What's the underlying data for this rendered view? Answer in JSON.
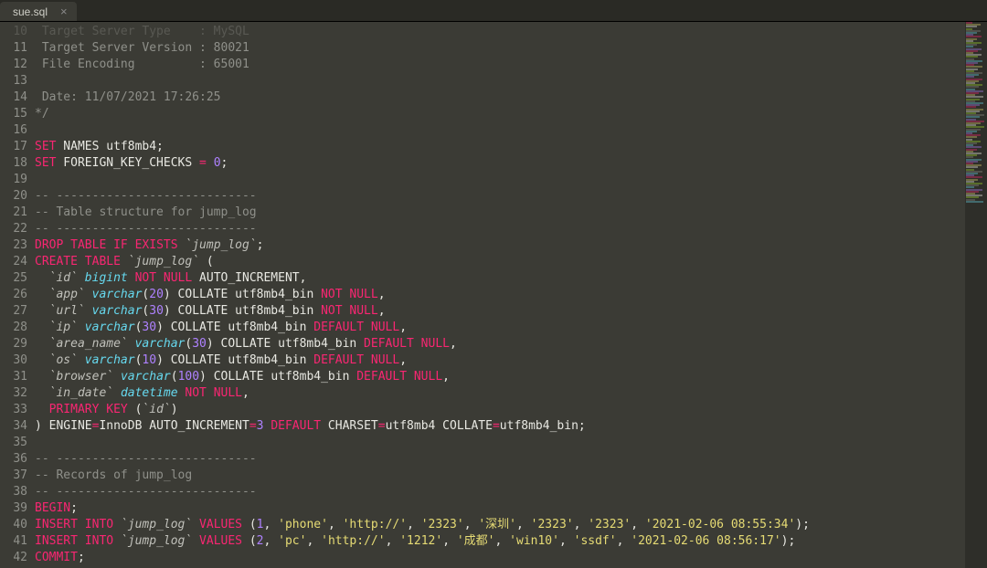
{
  "tab": {
    "title": "sue.sql",
    "close": "×"
  },
  "lines": [
    {
      "n": 10,
      "faded": true,
      "segs": [
        {
          "cls": "c-comment",
          "t": " Target Server Type    : MySQL"
        }
      ]
    },
    {
      "n": 11,
      "segs": [
        {
          "cls": "c-comment",
          "t": " Target Server Version : 80021"
        }
      ]
    },
    {
      "n": 12,
      "segs": [
        {
          "cls": "c-comment",
          "t": " File Encoding         : 65001"
        }
      ]
    },
    {
      "n": 13,
      "segs": [
        {
          "cls": "c-comment",
          "t": ""
        }
      ]
    },
    {
      "n": 14,
      "segs": [
        {
          "cls": "c-comment",
          "t": " Date: 11/07/2021 17:26:25"
        }
      ]
    },
    {
      "n": 15,
      "segs": [
        {
          "cls": "c-comment",
          "t": "*/"
        }
      ]
    },
    {
      "n": 16,
      "segs": [
        {
          "cls": "",
          "t": ""
        }
      ]
    },
    {
      "n": 17,
      "segs": [
        {
          "cls": "c-kw",
          "t": "SET"
        },
        {
          "cls": "c-plain",
          "t": " NAMES utf8mb4;"
        }
      ]
    },
    {
      "n": 18,
      "segs": [
        {
          "cls": "c-kw",
          "t": "SET"
        },
        {
          "cls": "c-plain",
          "t": " FOREIGN_KEY_CHECKS "
        },
        {
          "cls": "c-kw",
          "t": "="
        },
        {
          "cls": "c-plain",
          "t": " "
        },
        {
          "cls": "c-num",
          "t": "0"
        },
        {
          "cls": "c-plain",
          "t": ";"
        }
      ]
    },
    {
      "n": 19,
      "segs": [
        {
          "cls": "",
          "t": ""
        }
      ]
    },
    {
      "n": 20,
      "segs": [
        {
          "cls": "c-comment",
          "t": "-- ----------------------------"
        }
      ]
    },
    {
      "n": 21,
      "segs": [
        {
          "cls": "c-comment",
          "t": "-- Table structure for jump_log"
        }
      ]
    },
    {
      "n": 22,
      "segs": [
        {
          "cls": "c-comment",
          "t": "-- ----------------------------"
        }
      ]
    },
    {
      "n": 23,
      "segs": [
        {
          "cls": "c-kw",
          "t": "DROP"
        },
        {
          "cls": "c-plain",
          "t": " "
        },
        {
          "cls": "c-kw",
          "t": "TABLE"
        },
        {
          "cls": "c-plain",
          "t": " "
        },
        {
          "cls": "c-kw",
          "t": "IF"
        },
        {
          "cls": "c-plain",
          "t": " "
        },
        {
          "cls": "c-kw",
          "t": "EXISTS"
        },
        {
          "cls": "c-plain",
          "t": " "
        },
        {
          "cls": "c-tbl",
          "t": "`jump_log`"
        },
        {
          "cls": "c-plain",
          "t": ";"
        }
      ]
    },
    {
      "n": 24,
      "segs": [
        {
          "cls": "c-kw",
          "t": "CREATE"
        },
        {
          "cls": "c-plain",
          "t": " "
        },
        {
          "cls": "c-kw",
          "t": "TABLE"
        },
        {
          "cls": "c-plain",
          "t": " "
        },
        {
          "cls": "c-tbl",
          "t": "`jump_log`"
        },
        {
          "cls": "c-plain",
          "t": " ("
        }
      ]
    },
    {
      "n": 25,
      "segs": [
        {
          "cls": "c-plain",
          "t": "  "
        },
        {
          "cls": "c-tbl",
          "t": "`id`"
        },
        {
          "cls": "c-plain",
          "t": " "
        },
        {
          "cls": "c-type",
          "t": "bigint"
        },
        {
          "cls": "c-plain",
          "t": " "
        },
        {
          "cls": "c-kw",
          "t": "NOT"
        },
        {
          "cls": "c-plain",
          "t": " "
        },
        {
          "cls": "c-kw",
          "t": "NULL"
        },
        {
          "cls": "c-plain",
          "t": " AUTO_INCREMENT,"
        }
      ]
    },
    {
      "n": 26,
      "segs": [
        {
          "cls": "c-plain",
          "t": "  "
        },
        {
          "cls": "c-tbl",
          "t": "`app`"
        },
        {
          "cls": "c-plain",
          "t": " "
        },
        {
          "cls": "c-type",
          "t": "varchar"
        },
        {
          "cls": "c-plain",
          "t": "("
        },
        {
          "cls": "c-num",
          "t": "20"
        },
        {
          "cls": "c-plain",
          "t": ") COLLATE utf8mb4_bin "
        },
        {
          "cls": "c-kw",
          "t": "NOT"
        },
        {
          "cls": "c-plain",
          "t": " "
        },
        {
          "cls": "c-kw",
          "t": "NULL"
        },
        {
          "cls": "c-plain",
          "t": ","
        }
      ]
    },
    {
      "n": 27,
      "segs": [
        {
          "cls": "c-plain",
          "t": "  "
        },
        {
          "cls": "c-tbl",
          "t": "`url`"
        },
        {
          "cls": "c-plain",
          "t": " "
        },
        {
          "cls": "c-type",
          "t": "varchar"
        },
        {
          "cls": "c-plain",
          "t": "("
        },
        {
          "cls": "c-num",
          "t": "30"
        },
        {
          "cls": "c-plain",
          "t": ") COLLATE utf8mb4_bin "
        },
        {
          "cls": "c-kw",
          "t": "NOT"
        },
        {
          "cls": "c-plain",
          "t": " "
        },
        {
          "cls": "c-kw",
          "t": "NULL"
        },
        {
          "cls": "c-plain",
          "t": ","
        }
      ]
    },
    {
      "n": 28,
      "segs": [
        {
          "cls": "c-plain",
          "t": "  "
        },
        {
          "cls": "c-tbl",
          "t": "`ip`"
        },
        {
          "cls": "c-plain",
          "t": " "
        },
        {
          "cls": "c-type",
          "t": "varchar"
        },
        {
          "cls": "c-plain",
          "t": "("
        },
        {
          "cls": "c-num",
          "t": "30"
        },
        {
          "cls": "c-plain",
          "t": ") COLLATE utf8mb4_bin "
        },
        {
          "cls": "c-kw",
          "t": "DEFAULT"
        },
        {
          "cls": "c-plain",
          "t": " "
        },
        {
          "cls": "c-kw",
          "t": "NULL"
        },
        {
          "cls": "c-plain",
          "t": ","
        }
      ]
    },
    {
      "n": 29,
      "segs": [
        {
          "cls": "c-plain",
          "t": "  "
        },
        {
          "cls": "c-tbl",
          "t": "`area_name`"
        },
        {
          "cls": "c-plain",
          "t": " "
        },
        {
          "cls": "c-type",
          "t": "varchar"
        },
        {
          "cls": "c-plain",
          "t": "("
        },
        {
          "cls": "c-num",
          "t": "30"
        },
        {
          "cls": "c-plain",
          "t": ") COLLATE utf8mb4_bin "
        },
        {
          "cls": "c-kw",
          "t": "DEFAULT"
        },
        {
          "cls": "c-plain",
          "t": " "
        },
        {
          "cls": "c-kw",
          "t": "NULL"
        },
        {
          "cls": "c-plain",
          "t": ","
        }
      ]
    },
    {
      "n": 30,
      "segs": [
        {
          "cls": "c-plain",
          "t": "  "
        },
        {
          "cls": "c-tbl",
          "t": "`os`"
        },
        {
          "cls": "c-plain",
          "t": " "
        },
        {
          "cls": "c-type",
          "t": "varchar"
        },
        {
          "cls": "c-plain",
          "t": "("
        },
        {
          "cls": "c-num",
          "t": "10"
        },
        {
          "cls": "c-plain",
          "t": ") COLLATE utf8mb4_bin "
        },
        {
          "cls": "c-kw",
          "t": "DEFAULT"
        },
        {
          "cls": "c-plain",
          "t": " "
        },
        {
          "cls": "c-kw",
          "t": "NULL"
        },
        {
          "cls": "c-plain",
          "t": ","
        }
      ]
    },
    {
      "n": 31,
      "segs": [
        {
          "cls": "c-plain",
          "t": "  "
        },
        {
          "cls": "c-tbl",
          "t": "`browser`"
        },
        {
          "cls": "c-plain",
          "t": " "
        },
        {
          "cls": "c-type",
          "t": "varchar"
        },
        {
          "cls": "c-plain",
          "t": "("
        },
        {
          "cls": "c-num",
          "t": "100"
        },
        {
          "cls": "c-plain",
          "t": ") COLLATE utf8mb4_bin "
        },
        {
          "cls": "c-kw",
          "t": "DEFAULT"
        },
        {
          "cls": "c-plain",
          "t": " "
        },
        {
          "cls": "c-kw",
          "t": "NULL"
        },
        {
          "cls": "c-plain",
          "t": ","
        }
      ]
    },
    {
      "n": 32,
      "segs": [
        {
          "cls": "c-plain",
          "t": "  "
        },
        {
          "cls": "c-tbl",
          "t": "`in_date`"
        },
        {
          "cls": "c-plain",
          "t": " "
        },
        {
          "cls": "c-type",
          "t": "datetime"
        },
        {
          "cls": "c-plain",
          "t": " "
        },
        {
          "cls": "c-kw",
          "t": "NOT"
        },
        {
          "cls": "c-plain",
          "t": " "
        },
        {
          "cls": "c-kw",
          "t": "NULL"
        },
        {
          "cls": "c-plain",
          "t": ","
        }
      ]
    },
    {
      "n": 33,
      "segs": [
        {
          "cls": "c-plain",
          "t": "  "
        },
        {
          "cls": "c-kw",
          "t": "PRIMARY"
        },
        {
          "cls": "c-plain",
          "t": " "
        },
        {
          "cls": "c-kw",
          "t": "KEY"
        },
        {
          "cls": "c-plain",
          "t": " ("
        },
        {
          "cls": "c-tbl",
          "t": "`id`"
        },
        {
          "cls": "c-plain",
          "t": ")"
        }
      ]
    },
    {
      "n": 34,
      "segs": [
        {
          "cls": "c-plain",
          "t": ") ENGINE"
        },
        {
          "cls": "c-kw",
          "t": "="
        },
        {
          "cls": "c-plain",
          "t": "InnoDB AUTO_INCREMENT"
        },
        {
          "cls": "c-kw",
          "t": "="
        },
        {
          "cls": "c-num",
          "t": "3"
        },
        {
          "cls": "c-plain",
          "t": " "
        },
        {
          "cls": "c-kw",
          "t": "DEFAULT"
        },
        {
          "cls": "c-plain",
          "t": " CHARSET"
        },
        {
          "cls": "c-kw",
          "t": "="
        },
        {
          "cls": "c-plain",
          "t": "utf8mb4 COLLATE"
        },
        {
          "cls": "c-kw",
          "t": "="
        },
        {
          "cls": "c-plain",
          "t": "utf8mb4_bin;"
        }
      ]
    },
    {
      "n": 35,
      "segs": [
        {
          "cls": "",
          "t": ""
        }
      ]
    },
    {
      "n": 36,
      "segs": [
        {
          "cls": "c-comment",
          "t": "-- ----------------------------"
        }
      ]
    },
    {
      "n": 37,
      "segs": [
        {
          "cls": "c-comment",
          "t": "-- Records of jump_log"
        }
      ]
    },
    {
      "n": 38,
      "segs": [
        {
          "cls": "c-comment",
          "t": "-- ----------------------------"
        }
      ]
    },
    {
      "n": 39,
      "segs": [
        {
          "cls": "c-kw",
          "t": "BEGIN"
        },
        {
          "cls": "c-plain",
          "t": ";"
        }
      ]
    },
    {
      "n": 40,
      "segs": [
        {
          "cls": "c-kw",
          "t": "INSERT"
        },
        {
          "cls": "c-plain",
          "t": " "
        },
        {
          "cls": "c-kw",
          "t": "INTO"
        },
        {
          "cls": "c-plain",
          "t": " "
        },
        {
          "cls": "c-tbl",
          "t": "`jump_log`"
        },
        {
          "cls": "c-plain",
          "t": " "
        },
        {
          "cls": "c-kw",
          "t": "VALUES"
        },
        {
          "cls": "c-plain",
          "t": " ("
        },
        {
          "cls": "c-num",
          "t": "1"
        },
        {
          "cls": "c-plain",
          "t": ", "
        },
        {
          "cls": "c-str",
          "t": "'phone'"
        },
        {
          "cls": "c-plain",
          "t": ", "
        },
        {
          "cls": "c-str",
          "t": "'http://'"
        },
        {
          "cls": "c-plain",
          "t": ", "
        },
        {
          "cls": "c-str",
          "t": "'2323'"
        },
        {
          "cls": "c-plain",
          "t": ", "
        },
        {
          "cls": "c-str",
          "t": "'深圳'"
        },
        {
          "cls": "c-plain",
          "t": ", "
        },
        {
          "cls": "c-str",
          "t": "'2323'"
        },
        {
          "cls": "c-plain",
          "t": ", "
        },
        {
          "cls": "c-str",
          "t": "'2323'"
        },
        {
          "cls": "c-plain",
          "t": ", "
        },
        {
          "cls": "c-str",
          "t": "'2021-02-06 08:55:34'"
        },
        {
          "cls": "c-plain",
          "t": ");"
        }
      ]
    },
    {
      "n": 41,
      "segs": [
        {
          "cls": "c-kw",
          "t": "INSERT"
        },
        {
          "cls": "c-plain",
          "t": " "
        },
        {
          "cls": "c-kw",
          "t": "INTO"
        },
        {
          "cls": "c-plain",
          "t": " "
        },
        {
          "cls": "c-tbl",
          "t": "`jump_log`"
        },
        {
          "cls": "c-plain",
          "t": " "
        },
        {
          "cls": "c-kw",
          "t": "VALUES"
        },
        {
          "cls": "c-plain",
          "t": " ("
        },
        {
          "cls": "c-num",
          "t": "2"
        },
        {
          "cls": "c-plain",
          "t": ", "
        },
        {
          "cls": "c-str",
          "t": "'pc'"
        },
        {
          "cls": "c-plain",
          "t": ", "
        },
        {
          "cls": "c-str",
          "t": "'http://'"
        },
        {
          "cls": "c-plain",
          "t": ", "
        },
        {
          "cls": "c-str",
          "t": "'1212'"
        },
        {
          "cls": "c-plain",
          "t": ", "
        },
        {
          "cls": "c-str",
          "t": "'成都'"
        },
        {
          "cls": "c-plain",
          "t": ", "
        },
        {
          "cls": "c-str",
          "t": "'win10'"
        },
        {
          "cls": "c-plain",
          "t": ", "
        },
        {
          "cls": "c-str",
          "t": "'ssdf'"
        },
        {
          "cls": "c-plain",
          "t": ", "
        },
        {
          "cls": "c-str",
          "t": "'2021-02-06 08:56:17'"
        },
        {
          "cls": "c-plain",
          "t": ");"
        }
      ]
    },
    {
      "n": 42,
      "segs": [
        {
          "cls": "c-kw",
          "t": "COMMIT"
        },
        {
          "cls": "c-plain",
          "t": ";"
        }
      ]
    }
  ],
  "minimap": {
    "colors": [
      "#f92672",
      "#66d9ef",
      "#a6e22e",
      "#e6db74",
      "#ae81ff",
      "#8f908a",
      "#f8f8f2"
    ]
  }
}
